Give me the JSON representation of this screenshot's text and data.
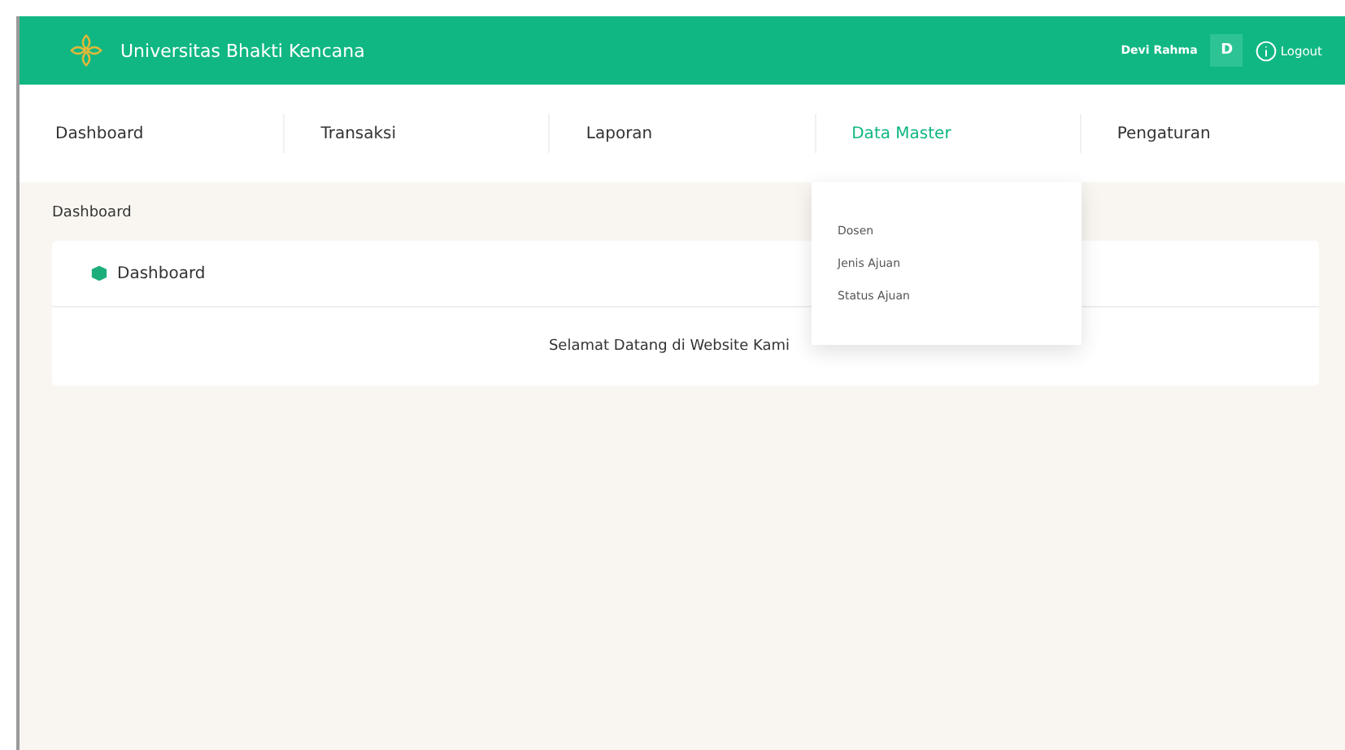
{
  "header": {
    "title": "Universitas Bhakti Kencana",
    "user_name": "Devi Rahma",
    "avatar_letter": "D",
    "logout": "Logout"
  },
  "nav": [
    {
      "label": "Dashboard",
      "selected": false
    },
    {
      "label": "Transaksi",
      "selected": false
    },
    {
      "label": "Laporan",
      "selected": false
    },
    {
      "label": "Data Master",
      "selected": true
    },
    {
      "label": "Pengaturan",
      "selected": false
    }
  ],
  "dropdown": {
    "items": [
      "Dosen",
      "Jenis Ajuan",
      "Status Ajuan"
    ]
  },
  "breadcrumb": "Dashboard",
  "card": {
    "title": "Dashboard",
    "message": "Selamat Datang di Website Kami"
  }
}
